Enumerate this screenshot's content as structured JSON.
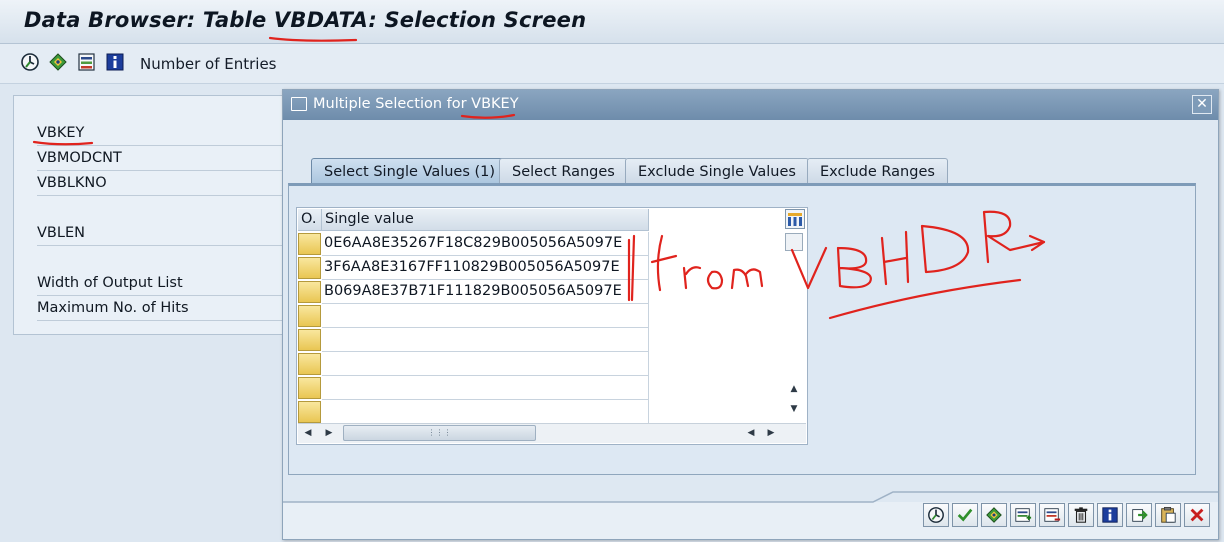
{
  "window": {
    "title": "Data Browser: Table VBDATA: Selection Screen"
  },
  "toolbar": {
    "icons": [
      "execute-icon",
      "get-variant-icon",
      "selection-options-icon",
      "info-icon"
    ],
    "number_of_entries_label": "Number of Entries"
  },
  "selection_fields": [
    {
      "label": "VBKEY"
    },
    {
      "label": "VBMODCNT"
    },
    {
      "label": "VBBLKNO"
    },
    {
      "label": "VBLEN"
    },
    {
      "label": "Width of Output List"
    },
    {
      "label": "Maximum No. of Hits"
    }
  ],
  "dialog": {
    "title": "Multiple Selection for VBKEY",
    "close_symbol": "✕",
    "tabs": [
      {
        "label": "Select Single Values (1)",
        "active": true
      },
      {
        "label": "Select Ranges",
        "active": false
      },
      {
        "label": "Exclude Single Values",
        "active": false
      },
      {
        "label": "Exclude Ranges",
        "active": false
      }
    ],
    "table": {
      "headers": {
        "option": "O.",
        "value": "Single value"
      },
      "rows": [
        "0E6AA8E35267F18C829B005056A5097E",
        "3F6AA8E3167FF110829B005056A5097E",
        "B069A8E37B71F111829B005056A5097E",
        "",
        "",
        "",
        "",
        ""
      ]
    },
    "footer_buttons": [
      "execute-icon",
      "copy-check-icon",
      "find-icon",
      "insert-row-icon",
      "delete-row-icon",
      "delete-all-icon",
      "info-icon",
      "import-icon",
      "paste-clipboard-icon",
      "cancel-icon"
    ]
  },
  "annotation": {
    "handwritten_note": "from VBHDR",
    "color": "#e0231d"
  },
  "colors": {
    "dialog_header": "#7e9bb8",
    "row_button": "#f2d36b",
    "annotation_red": "#e0231d"
  }
}
